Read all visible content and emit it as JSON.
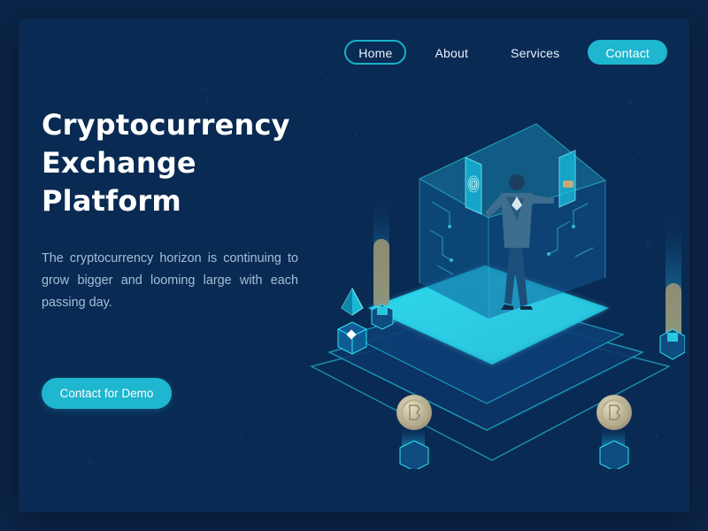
{
  "nav": {
    "items": [
      {
        "label": "Home",
        "active": true
      },
      {
        "label": "About"
      },
      {
        "label": "Services"
      },
      {
        "label": "Contact",
        "highlight": true
      }
    ]
  },
  "hero": {
    "title_lines": [
      "Cryptocurrency",
      "Exchange",
      "Platform"
    ],
    "description": "The cryptocurrency horizon is continuing to grow bigger and looming large with each passing day.",
    "cta_label": "Contact for Demo"
  },
  "colors": {
    "background": "#092a53",
    "accent": "#1fb6cf",
    "glow": "#2ee6f6",
    "text": "#ffffff",
    "muted_text": "#a5bfd7"
  },
  "illustration": {
    "icons": [
      "person-icon",
      "fingerprint-icon",
      "phone-icon",
      "ethereum-icon",
      "bitcoin-coin-icon",
      "crypto-cube-icon"
    ]
  }
}
